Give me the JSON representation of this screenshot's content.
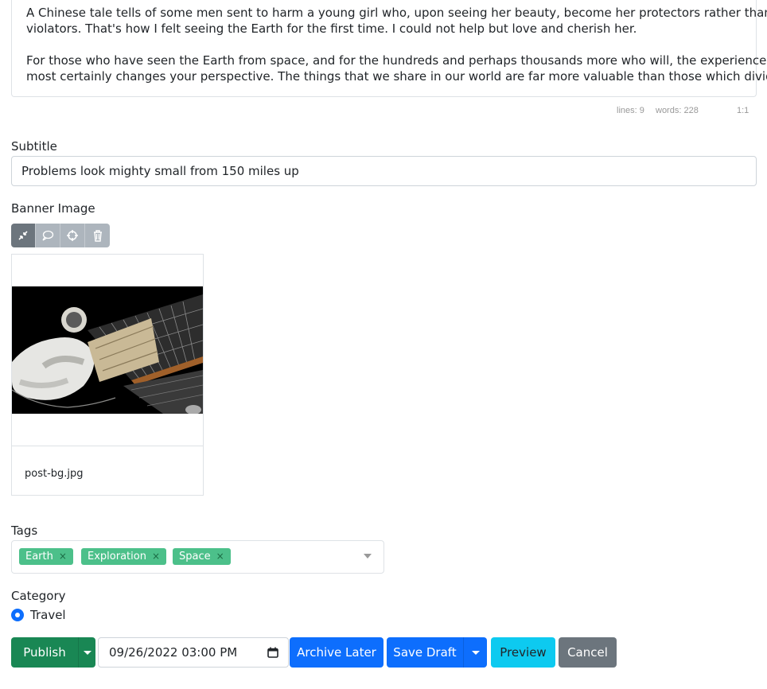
{
  "editor": {
    "lines": [
      "A Chinese tale tells of some men sent to harm a young girl who, upon seeing her beauty, become her protectors rather than her",
      "violators. That's how I felt seeing the Earth for the first time. I could not help but love and cherish her.",
      "For those who have seen the Earth from space, and for the hundreds and perhaps thousands more who will, the experience",
      "most certainly changes your perspective. The things that we share in our world are far more valuable than those which divide us."
    ],
    "status": {
      "lines": "lines: 9",
      "words": "words: 228",
      "cursor": "1:1"
    }
  },
  "subtitle": {
    "label": "Subtitle",
    "value": "Problems look mighty small from 150 miles up"
  },
  "banner": {
    "label": "Banner Image",
    "toolbar": [
      "collapse-icon",
      "comment-icon",
      "crosshair-icon",
      "trash-icon"
    ],
    "filename": "post-bg.jpg"
  },
  "tags": {
    "label": "Tags",
    "items": [
      {
        "label": "Earth"
      },
      {
        "label": "Exploration"
      },
      {
        "label": "Space"
      }
    ],
    "remove_glyph": "×"
  },
  "category": {
    "label": "Category",
    "option": "Travel"
  },
  "actions": {
    "publish": "Publish",
    "datetime": "09/26/2022 03:00 PM",
    "archive_later": "Archive Later",
    "save_draft": "Save Draft",
    "preview": "Preview",
    "cancel": "Cancel"
  },
  "colors": {
    "primary": "#0d6efd",
    "success": "#198754",
    "info": "#0dcaf0",
    "secondary": "#6c757d",
    "tag": "#4cc08a"
  }
}
